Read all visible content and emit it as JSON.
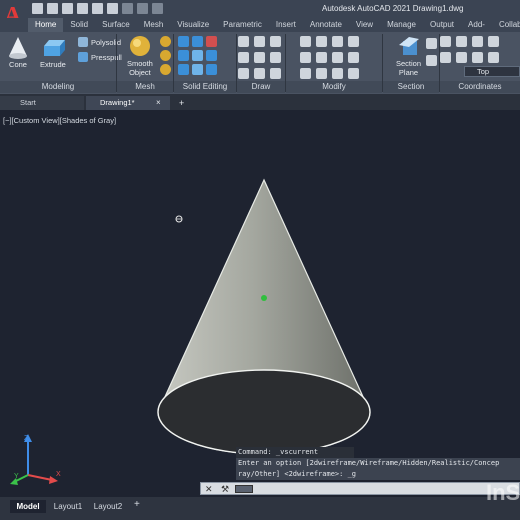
{
  "window": {
    "title": "Autodesk AutoCAD 2021    Drawing1.dwg",
    "app_logo": "A"
  },
  "ribbon": {
    "tabs": [
      "Home",
      "Solid",
      "Surface",
      "Mesh",
      "Visualize",
      "Parametric",
      "Insert",
      "Annotate",
      "View",
      "Manage",
      "Output",
      "Add-ins",
      "Collaborate"
    ],
    "active_tab": "Home",
    "tools": {
      "cone": "Cone",
      "extrude": "Extrude",
      "polysolid": "Polysolid",
      "presspull": "Presspull",
      "smooth_object_line1": "Smooth",
      "smooth_object_line2": "Object",
      "section_plane_line1": "Section",
      "section_plane_line2": "Plane"
    },
    "panels": [
      "Modeling",
      "Mesh",
      "Solid Editing",
      "Draw",
      "Modify",
      "Section",
      "Coordinates"
    ],
    "view_combo": "Top"
  },
  "filetabs": {
    "start": "Start",
    "drawing": "Drawing1*",
    "close": "×",
    "add": "+"
  },
  "viewport": {
    "label": "[−][Custom View][Shades of Gray]"
  },
  "command": {
    "history_line1": "Command: _vscurrent",
    "history_line2": "Enter an option [2dwireframe/Wireframe/Hidden/Realistic/Concep",
    "history_line3": "ray/Other] <2dwireframe>: _g"
  },
  "layout_tabs": {
    "model": "Model",
    "layout1": "Layout1",
    "layout2": "Layout2",
    "add": "+"
  },
  "watermark": "InS",
  "colors": {
    "background": "#1e2330",
    "ribbon": "#4a5362",
    "cone_light": "#b9bcb4",
    "cone_dark": "#6f736c",
    "cone_base": "#2a2c2e"
  }
}
